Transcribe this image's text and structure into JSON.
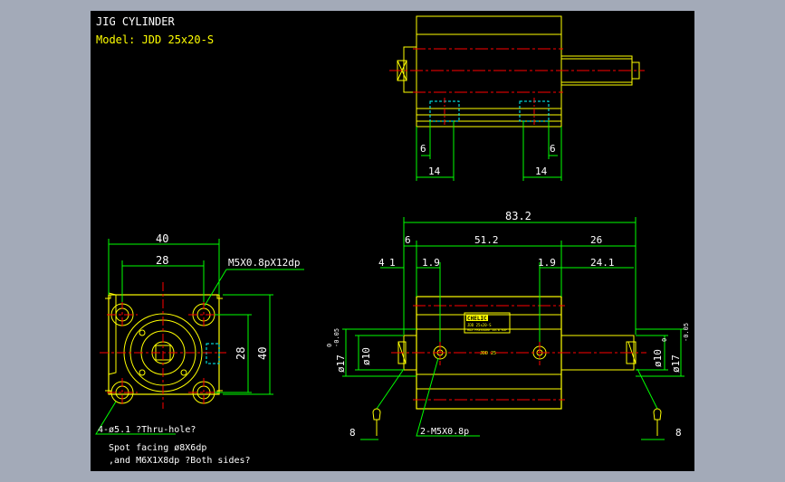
{
  "title_block": {
    "title": "JIG CYLINDER",
    "model": "Model: JDD 25x20-S"
  },
  "top_view": {
    "dim_left_small": "6",
    "dim_left_large": "14",
    "dim_right_small": "6",
    "dim_right_large": "14"
  },
  "front_view": {
    "dim_width_outer": "40",
    "dim_width_inner": "28",
    "dim_height_inner": "28",
    "dim_height_outer": "40",
    "thread_callout": "M5X0.8pX12dp",
    "hole_note_1": "4-ø5.1 ?Thru-hole?",
    "hole_note_2": "Spot facing  ø8X6dp",
    "hole_note_3": ",and M6X1X8dp ?Both sides?"
  },
  "side_view": {
    "dim_overall": "83.2",
    "dim_left_end": "6",
    "dim_body": "51.2",
    "dim_rod": "26",
    "dim_4": "4",
    "dim_1": "1",
    "dim_1_9_left": "1.9",
    "dim_1_9_right": "1.9",
    "dim_24_1": "24.1",
    "dia_10_left": "ø10",
    "dia_17_left": "ø17",
    "tol_17_left_upper": "0",
    "tol_17_left_lower": "-0.05",
    "dia_10_right": "ø10",
    "dia_17_right": "ø17",
    "tol_17_right_upper": "0",
    "tol_17_right_lower": "-0.05",
    "dim_8_left": "8",
    "dim_8_right": "8",
    "port_callout": "2-M5X0.8p",
    "label_brand": "CHELIC",
    "label_line_2": "JDD 25x20-S",
    "label_line_3": "MAX PRESSURE 10.0 KGF",
    "body_marking": "JDD 25"
  },
  "colors": {
    "background": "#000000",
    "frame": "#a3aab8",
    "outline": "#ffff00",
    "center_line": "#ff0000",
    "hidden_line": "#00ffff",
    "dimension": "#00ff00",
    "text": "#ffffff"
  }
}
